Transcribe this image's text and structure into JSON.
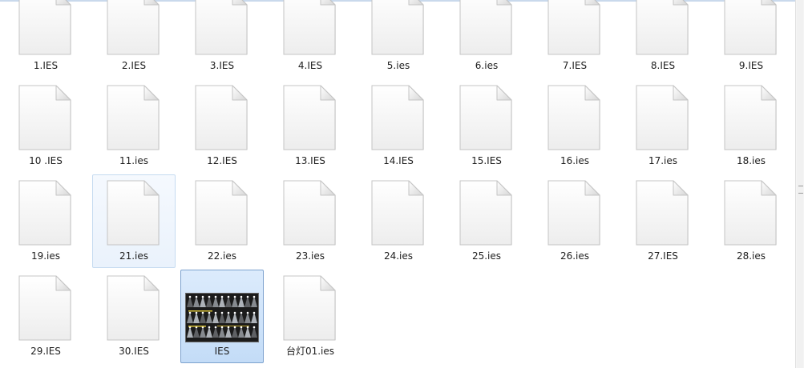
{
  "files": [
    {
      "name": "1.IES",
      "kind": "file"
    },
    {
      "name": "2.IES",
      "kind": "file"
    },
    {
      "name": "3.IES",
      "kind": "file"
    },
    {
      "name": "4.IES",
      "kind": "file"
    },
    {
      "name": "5.ies",
      "kind": "file"
    },
    {
      "name": "6.ies",
      "kind": "file"
    },
    {
      "name": "7.IES",
      "kind": "file"
    },
    {
      "name": "8.IES",
      "kind": "file"
    },
    {
      "name": "9.IES",
      "kind": "file"
    },
    {
      "name": "10 .IES",
      "kind": "file"
    },
    {
      "name": "11.ies",
      "kind": "file"
    },
    {
      "name": "12.IES",
      "kind": "file"
    },
    {
      "name": "13.IES",
      "kind": "file"
    },
    {
      "name": "14.IES",
      "kind": "file"
    },
    {
      "name": "15.IES",
      "kind": "file"
    },
    {
      "name": "16.ies",
      "kind": "file"
    },
    {
      "name": "17.ies",
      "kind": "file"
    },
    {
      "name": "18.ies",
      "kind": "file"
    },
    {
      "name": "19.ies",
      "kind": "file"
    },
    {
      "name": "21.ies",
      "kind": "file",
      "state": "hover"
    },
    {
      "name": "22.ies",
      "kind": "file"
    },
    {
      "name": "23.ies",
      "kind": "file"
    },
    {
      "name": "24.ies",
      "kind": "file"
    },
    {
      "name": "25.ies",
      "kind": "file"
    },
    {
      "name": "26.ies",
      "kind": "file"
    },
    {
      "name": "27.IES",
      "kind": "file"
    },
    {
      "name": "28.ies",
      "kind": "file"
    },
    {
      "name": "29.IES",
      "kind": "file"
    },
    {
      "name": "30.IES",
      "kind": "file"
    },
    {
      "name": "IES",
      "kind": "image-folder",
      "state": "selected"
    },
    {
      "name": "台灯01.ies",
      "kind": "file"
    }
  ],
  "colors": {
    "selection": "#c3dcf7",
    "hover": "#eaf2fc",
    "label_text": "#1e1e1e"
  }
}
